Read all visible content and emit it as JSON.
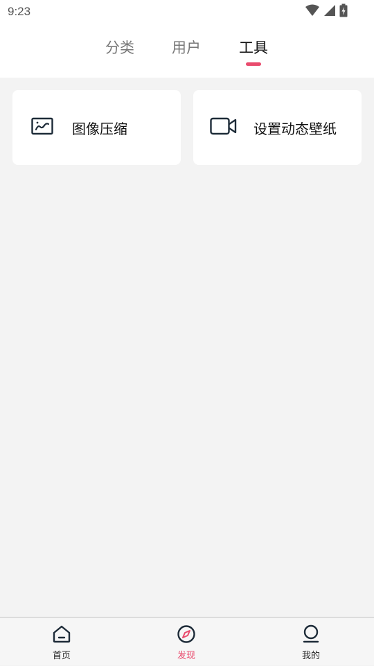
{
  "status_bar": {
    "time": "9:23",
    "icons": [
      "wifi-icon",
      "signal-icon",
      "battery-charging-icon"
    ]
  },
  "tabs": [
    {
      "label": "分类",
      "active": false
    },
    {
      "label": "用户",
      "active": false
    },
    {
      "label": "工具",
      "active": true
    }
  ],
  "tools": [
    {
      "label": "图像压缩",
      "icon": "image-icon"
    },
    {
      "label": "设置动态壁纸",
      "icon": "video-camera-icon"
    }
  ],
  "bottom_nav": [
    {
      "label": "首页",
      "icon": "home-icon",
      "active": false
    },
    {
      "label": "发现",
      "icon": "compass-icon",
      "active": true
    },
    {
      "label": "我的",
      "icon": "user-icon",
      "active": false
    }
  ],
  "colors": {
    "accent": "#e94b6d",
    "icon_dark": "#1d2b38",
    "background": "#f3f3f3",
    "card": "#ffffff"
  }
}
